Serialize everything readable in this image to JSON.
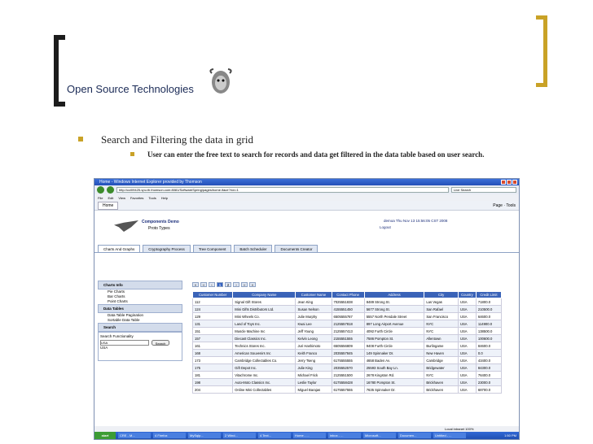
{
  "slide": {
    "title": "Open Source Technologies",
    "bullet1": "Search and Filtering the data in grid",
    "bullet2": "User can enter the free text to search for records and data get filtered in the data table based on user search."
  },
  "browser": {
    "window_title": "Home - Windows Internet Explorer provided by Thomson",
    "url": "http://ccl09425-vpu.th.thomson.com:8081/SoftwareSpring/pages/home.iface?rvn=1",
    "search_placeholder": "Live Search",
    "menu": [
      "File",
      "Edit",
      "View",
      "Favorites",
      "Tools",
      "Help"
    ],
    "tab_label": "Home",
    "page_tools": "Page",
    "tools": "Tools",
    "status": "Local intranet",
    "zoom": "100%",
    "clock": "1:50 PM",
    "start_label": "start",
    "taskbar_items": [
      "CRE - M...",
      "4 Firefox",
      "MySqlp...",
      "2 Wind...",
      "4 Text...",
      "Home - ...",
      "inbox - ...",
      "Microsoft...",
      "Documen...",
      "Untitled - ..."
    ]
  },
  "app": {
    "brand": "Components Demo",
    "brand_sub": "Proto Types",
    "user": "demoa  Thu Nov 13 15:56:05 CST 2008",
    "logout": "Logout",
    "tabs": [
      "Charts And Graphs",
      "Cryptography Process",
      "Tree Component",
      "Batch Scheduler",
      "Documents Creator"
    ],
    "sidebar": {
      "charts_header": "Charts Info",
      "charts_items": [
        "Pie Charts",
        "Bar Charts",
        "Point Charts"
      ],
      "tables_header": "Data Tables",
      "tables_items": [
        "Data Table Pagination",
        "Sortable Data Table"
      ],
      "search_header": "Search",
      "search_title": "Search Functionality",
      "search_value": "USA",
      "search_button": "Search",
      "search_result": "USA"
    },
    "pager": {
      "current": "1",
      "next": "2"
    },
    "table": {
      "headers": [
        "Customer Number",
        "Company Name",
        "Customer Name",
        "Contact Phone",
        "Address",
        "City",
        "Country",
        "Credit Limit"
      ],
      "rows": [
        [
          "112",
          "Signal Gift Stores",
          "Jean King",
          "7025551838",
          "8489 Strong St.",
          "Las Vegas",
          "USA",
          "71800.0"
        ],
        [
          "124",
          "Mini Gifts Distributors Ltd.",
          "Susan Nelson",
          "4155551450",
          "5677 Strong St.",
          "San Rafael",
          "USA",
          "210500.0"
        ],
        [
          "129",
          "Mini Wheels Co.",
          "Julie Murphy",
          "6505555787",
          "5557 North Pendale Street",
          "San Francisco",
          "USA",
          "64600.0"
        ],
        [
          "131",
          "Land of Toys Inc.",
          "Kwai Lee",
          "2125557818",
          "897 Long Airport Avenue",
          "NYC",
          "USA",
          "114900.0"
        ],
        [
          "151",
          "Muscle Machine Inc",
          "Jeff Young",
          "2125557413",
          "4092 Furth Circle",
          "NYC",
          "USA",
          "138500.0"
        ],
        [
          "157",
          "Diecast Classics Inc.",
          "Kelvin Leong",
          "2155551555",
          "7586 Pompton St.",
          "Allentown",
          "USA",
          "100600.0"
        ],
        [
          "161",
          "Technics Stores Inc.",
          "Juri Hashimoto",
          "6505556809",
          "9408 Furth Circle",
          "Burlingame",
          "USA",
          "84600.0"
        ],
        [
          "168",
          "American Souvenirs Inc",
          "Keith Franco",
          "2035557845",
          "149 Spinnaker Dr.",
          "New Haven",
          "USA",
          "0.0"
        ],
        [
          "173",
          "Cambridge Collectables Co.",
          "Jerry Tseng",
          "6175555555",
          "4658 Baden Av.",
          "Cambridge",
          "USA",
          "43400.0"
        ],
        [
          "175",
          "Gift Depot Inc.",
          "Julie King",
          "2035552570",
          "25593 South Bay Ln.",
          "Bridgewater",
          "USA",
          "84300.0"
        ],
        [
          "181",
          "Vitachrome Inc.",
          "Michael Frick",
          "2125551500",
          "2678 Kingston Rd.",
          "NYC",
          "USA",
          "76400.0"
        ],
        [
          "198",
          "Auto-Moto Classics Inc.",
          "Leslie Taylor",
          "6175558428",
          "16780 Pompton St.",
          "Brickhaven",
          "USA",
          "23000.0"
        ],
        [
          "204",
          "Online Mini Collectables",
          "Miguel Barajas",
          "6175557555",
          "7635 Spinnaker Dr.",
          "Brickhaven",
          "USA",
          "68700.0"
        ]
      ]
    }
  }
}
